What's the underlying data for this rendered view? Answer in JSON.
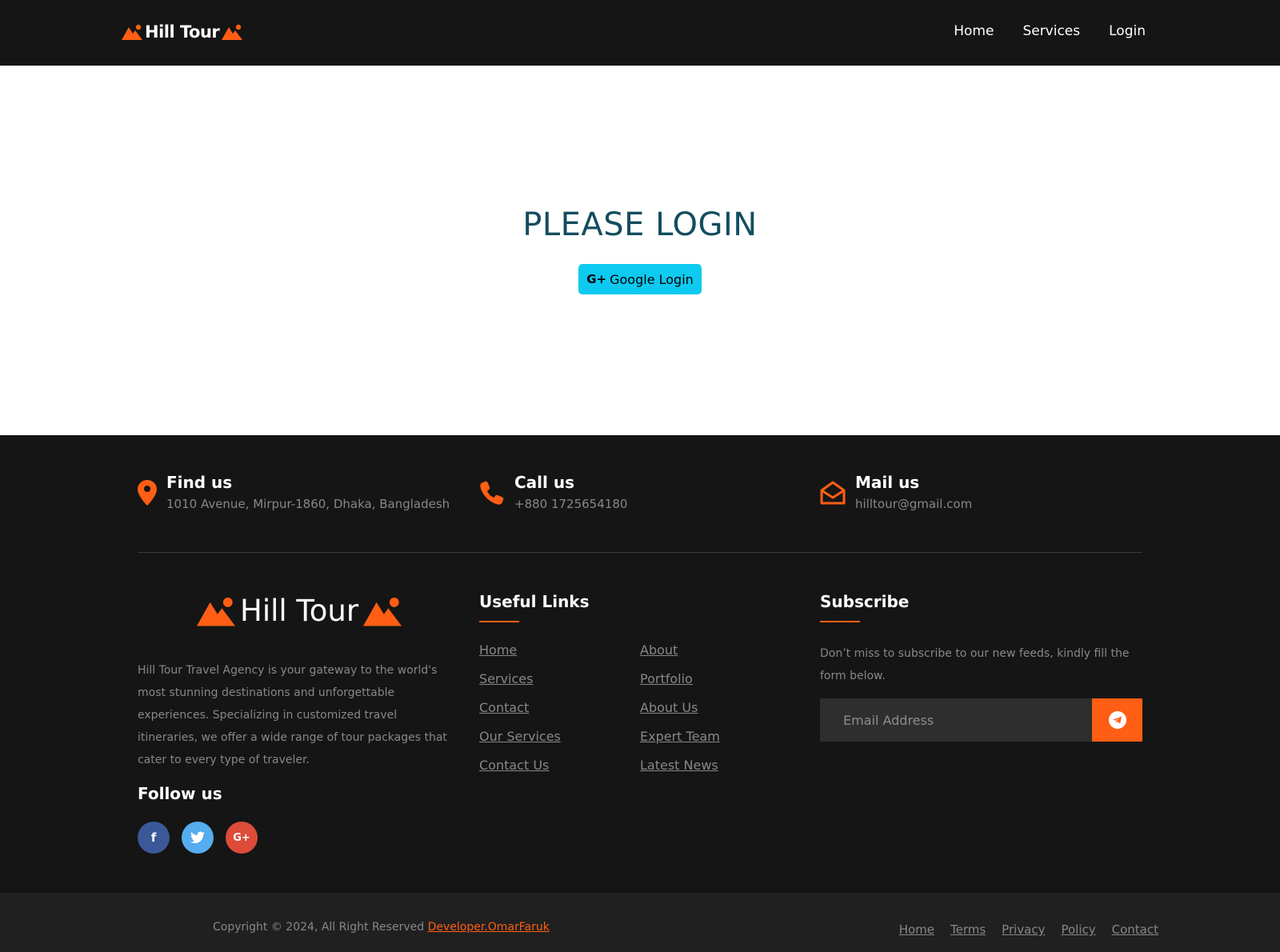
{
  "navbar": {
    "brand": "Hill Tour",
    "links": [
      "Home",
      "Services",
      "Login"
    ]
  },
  "hero": {
    "title": "PLEASE LOGIN",
    "google_button": "Google Login"
  },
  "contacts": [
    {
      "icon": "map-marker-icon",
      "title": "Find us",
      "value": "1010 Avenue, Mirpur-1860, Dhaka, Bangladesh"
    },
    {
      "icon": "phone-icon",
      "title": "Call us",
      "value": "+880 1725654180"
    },
    {
      "icon": "envelope-open-icon",
      "title": "Mail us",
      "value": "hilltour@gmail.com"
    }
  ],
  "footer": {
    "logo": "Hill Tour",
    "about": "Hill Tour Travel Agency is your gateway to the world's most stunning destinations and unforgettable experiences. Specializing in customized travel itineraries, we offer a wide range of tour packages that cater to every type of traveler.",
    "follow_title": "Follow us",
    "socials": [
      {
        "name": "facebook",
        "glyph": "f",
        "color": "#3b5998"
      },
      {
        "name": "twitter",
        "glyph": "t",
        "color": "#55acee"
      },
      {
        "name": "google-plus",
        "glyph": "G+",
        "color": "#dd4b39"
      }
    ],
    "useful_links_title": "Useful Links",
    "useful_links_left": [
      "Home",
      "Services",
      "Contact",
      "Our Services",
      "Contact Us"
    ],
    "useful_links_right": [
      "About",
      "Portfolio",
      "About Us",
      "Expert Team",
      "Latest News"
    ],
    "subscribe_title": "Subscribe",
    "subscribe_text": "Don’t miss to subscribe to our new feeds, kindly fill the form below.",
    "email_placeholder": "Email Address"
  },
  "bottom": {
    "copyright": "Copyright © 2024, All Right Reserved",
    "developer": "Developer.OmarFaruk",
    "links": [
      "Home",
      "Terms",
      "Privacy",
      "Policy",
      "Contact"
    ]
  },
  "colors": {
    "accent": "#ff5e14",
    "dark": "#151515",
    "title": "#144d5e",
    "google_button": "#0dcaf0"
  }
}
